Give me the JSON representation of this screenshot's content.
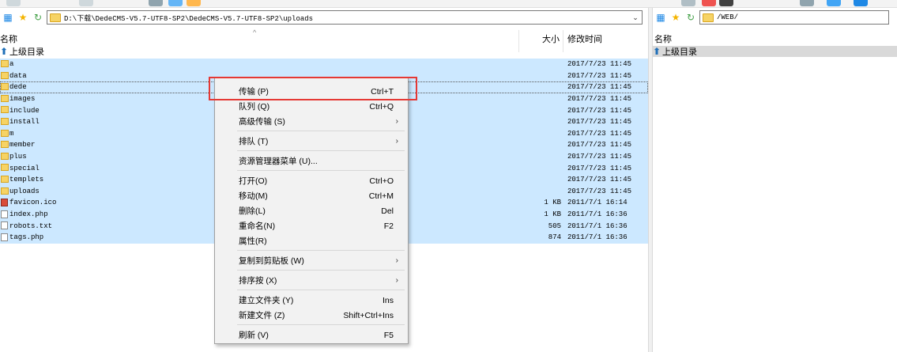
{
  "toolbar": {
    "icons": [
      "refresh-icon",
      "back-icon",
      "forward-icon",
      "compare-icon",
      "sync-icon",
      "transfer-icon",
      "filter-icon",
      "delete-icon",
      "queue-icon",
      "settings-icon",
      "help-icon"
    ]
  },
  "local": {
    "address": "D:\\下载\\DedeCMS-V5.7-UTF8-SP2\\DedeCMS-V5.7-UTF8-SP2\\uploads",
    "columns": {
      "name": "名称",
      "size": "大小",
      "modified": "修改时间"
    },
    "up_label": "上级目录",
    "rows": [
      {
        "name": "a",
        "size": "",
        "time": "2017/7/23 11:45",
        "type": "folder"
      },
      {
        "name": "data",
        "size": "",
        "time": "2017/7/23 11:45",
        "type": "folder"
      },
      {
        "name": "dede",
        "size": "",
        "time": "2017/7/23 11:45",
        "type": "folder"
      },
      {
        "name": "images",
        "size": "",
        "time": "2017/7/23 11:45",
        "type": "folder"
      },
      {
        "name": "include",
        "size": "",
        "time": "2017/7/23 11:45",
        "type": "folder"
      },
      {
        "name": "install",
        "size": "",
        "time": "2017/7/23 11:45",
        "type": "folder"
      },
      {
        "name": "m",
        "size": "",
        "time": "2017/7/23 11:45",
        "type": "folder"
      },
      {
        "name": "member",
        "size": "",
        "time": "2017/7/23 11:45",
        "type": "folder"
      },
      {
        "name": "plus",
        "size": "",
        "time": "2017/7/23 11:45",
        "type": "folder"
      },
      {
        "name": "special",
        "size": "",
        "time": "2017/7/23 11:45",
        "type": "folder"
      },
      {
        "name": "templets",
        "size": "",
        "time": "2017/7/23 11:45",
        "type": "folder"
      },
      {
        "name": "uploads",
        "size": "",
        "time": "2017/7/23 11:45",
        "type": "folder"
      },
      {
        "name": "favicon.ico",
        "size": "1 KB",
        "time": "2011/7/1 16:14",
        "type": "ico"
      },
      {
        "name": "index.php",
        "size": "1 KB",
        "time": "2011/7/1 16:36",
        "type": "file"
      },
      {
        "name": "robots.txt",
        "size": "505",
        "time": "2011/7/1 16:36",
        "type": "file"
      },
      {
        "name": "tags.php",
        "size": "874",
        "time": "2011/7/1 16:36",
        "type": "file"
      }
    ]
  },
  "remote": {
    "address": "/WEB/",
    "columns": {
      "name": "名称"
    },
    "up_label": "上级目录"
  },
  "context_menu": {
    "items": [
      {
        "label": "传输 (P)",
        "shortcut": "Ctrl+T",
        "submenu": false
      },
      {
        "label": "队列 (Q)",
        "shortcut": "Ctrl+Q",
        "submenu": false
      },
      {
        "label": "高级传输 (S)",
        "shortcut": "",
        "submenu": true
      },
      {
        "sep": true
      },
      {
        "label": "排队 (T)",
        "shortcut": "",
        "submenu": true
      },
      {
        "sep": true
      },
      {
        "label": "资源管理器菜单 (U)...",
        "shortcut": "",
        "submenu": false
      },
      {
        "sep": true
      },
      {
        "label": "打开(O)",
        "shortcut": "Ctrl+O",
        "submenu": false
      },
      {
        "label": "移动(M)",
        "shortcut": "Ctrl+M",
        "submenu": false
      },
      {
        "label": "删除(L)",
        "shortcut": "Del",
        "submenu": false
      },
      {
        "label": "重命名(N)",
        "shortcut": "F2",
        "submenu": false
      },
      {
        "label": "属性(R)",
        "shortcut": "",
        "submenu": false
      },
      {
        "sep": true
      },
      {
        "label": "复制到剪贴板 (W)",
        "shortcut": "",
        "submenu": true
      },
      {
        "sep": true
      },
      {
        "label": "排序按 (X)",
        "shortcut": "",
        "submenu": true
      },
      {
        "sep": true
      },
      {
        "label": "建立文件夹 (Y)",
        "shortcut": "Ins",
        "submenu": false
      },
      {
        "label": "新建文件 (Z)",
        "shortcut": "Shift+Ctrl+Ins",
        "submenu": false
      },
      {
        "sep": true
      },
      {
        "label": "刷新 (V)",
        "shortcut": "F5",
        "submenu": false
      }
    ]
  },
  "colors": {
    "selection": "#cce8ff",
    "highlight_box": "#e53935",
    "menu_bg": "#f2f2f2"
  }
}
